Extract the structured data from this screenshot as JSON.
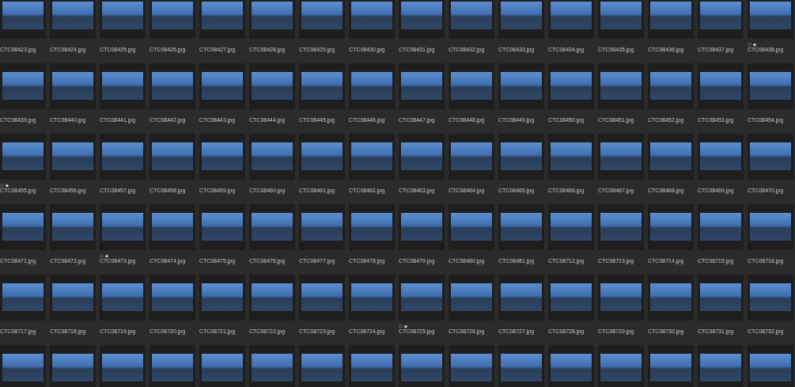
{
  "rows": [
    {
      "items": [
        {
          "filename": "CTC08423.jpg",
          "starred": false
        },
        {
          "filename": "CTC08424.jpg",
          "starred": false
        },
        {
          "filename": "CTC08425.jpg",
          "starred": false
        },
        {
          "filename": "CTC08426.jpg",
          "starred": false
        },
        {
          "filename": "CTC08427.jpg",
          "starred": false
        },
        {
          "filename": "CTC08428.jpg",
          "starred": false
        },
        {
          "filename": "CTC08429.jpg",
          "starred": false
        },
        {
          "filename": "CTC08430.jpg",
          "starred": false
        },
        {
          "filename": "CTC08431.jpg",
          "starred": false
        },
        {
          "filename": "CTC08432.jpg",
          "starred": false
        },
        {
          "filename": "CTC08433.jpg",
          "starred": false
        },
        {
          "filename": "CTC08434.jpg",
          "starred": false
        },
        {
          "filename": "CTC08435.jpg",
          "starred": false
        },
        {
          "filename": "CTC08436.jpg",
          "starred": false
        },
        {
          "filename": "CTC08437.jpg",
          "starred": false
        },
        {
          "filename": "CTC08438.jpg",
          "starred": true
        }
      ]
    },
    {
      "items": [
        {
          "filename": "CTC08439.jpg",
          "starred": false
        },
        {
          "filename": "CTC08440.jpg",
          "starred": false
        },
        {
          "filename": "CTC08441.jpg",
          "starred": false
        },
        {
          "filename": "CTC08442.jpg",
          "starred": false
        },
        {
          "filename": "CTC08443.jpg",
          "starred": false
        },
        {
          "filename": "CTC08444.jpg",
          "starred": false
        },
        {
          "filename": "CTC08445.jpg",
          "starred": false
        },
        {
          "filename": "CTC08446.jpg",
          "starred": false
        },
        {
          "filename": "CTC08447.jpg",
          "starred": false
        },
        {
          "filename": "CTC08448.jpg",
          "starred": false
        },
        {
          "filename": "CTC08449.jpg",
          "starred": false
        },
        {
          "filename": "CTC08450.jpg",
          "starred": false
        },
        {
          "filename": "CTC08451.jpg",
          "starred": false
        },
        {
          "filename": "CTC08452.jpg",
          "starred": false
        },
        {
          "filename": "CTC08453.jpg",
          "starred": false
        },
        {
          "filename": "CTC08454.jpg",
          "starred": false
        }
      ]
    },
    {
      "items": [
        {
          "filename": "CTC08455.jpg",
          "starred": true
        },
        {
          "filename": "CTC08456.jpg",
          "starred": false
        },
        {
          "filename": "CTC08457.jpg",
          "starred": false
        },
        {
          "filename": "CTC08458.jpg",
          "starred": false
        },
        {
          "filename": "CTC08459.jpg",
          "starred": false
        },
        {
          "filename": "CTC08460.jpg",
          "starred": false
        },
        {
          "filename": "CTC08461.jpg",
          "starred": false
        },
        {
          "filename": "CTC08462.jpg",
          "starred": false
        },
        {
          "filename": "CTC08463.jpg",
          "starred": false
        },
        {
          "filename": "CTC08464.jpg",
          "starred": false
        },
        {
          "filename": "CTC08465.jpg",
          "starred": false
        },
        {
          "filename": "CTC08466.jpg",
          "starred": false
        },
        {
          "filename": "CTC08467.jpg",
          "starred": false
        },
        {
          "filename": "CTC08468.jpg",
          "starred": false
        },
        {
          "filename": "CTC08469.jpg",
          "starred": false
        },
        {
          "filename": "CTC08470.jpg",
          "starred": false
        }
      ]
    },
    {
      "items": [
        {
          "filename": "CTC08471.jpg",
          "starred": false
        },
        {
          "filename": "CTC08472.jpg",
          "starred": false
        },
        {
          "filename": "CTC08473.jpg",
          "starred": true
        },
        {
          "filename": "CTC08474.jpg",
          "starred": false
        },
        {
          "filename": "CTC08475.jpg",
          "starred": false
        },
        {
          "filename": "CTC08476.jpg",
          "starred": false
        },
        {
          "filename": "CTC08477.jpg",
          "starred": false
        },
        {
          "filename": "CTC08478.jpg",
          "starred": false
        },
        {
          "filename": "CTC08479.jpg",
          "starred": false
        },
        {
          "filename": "CTC08480.jpg",
          "starred": false
        },
        {
          "filename": "CTC08481.jpg",
          "starred": false
        },
        {
          "filename": "CTC08712.jpg",
          "starred": false
        },
        {
          "filename": "CTC08713.jpg",
          "starred": false
        },
        {
          "filename": "CTC08714.jpg",
          "starred": false
        },
        {
          "filename": "CTC08715.jpg",
          "starred": false
        },
        {
          "filename": "CTC08716.jpg",
          "starred": false
        }
      ]
    },
    {
      "items": [
        {
          "filename": "CTC08717.jpg",
          "starred": false
        },
        {
          "filename": "CTC08718.jpg",
          "starred": false
        },
        {
          "filename": "CTC08719.jpg",
          "starred": false
        },
        {
          "filename": "CTC08720.jpg",
          "starred": false
        },
        {
          "filename": "CTC08721.jpg",
          "starred": false
        },
        {
          "filename": "CTC08722.jpg",
          "starred": false
        },
        {
          "filename": "CTC08723.jpg",
          "starred": false
        },
        {
          "filename": "CTC08724.jpg",
          "starred": false
        },
        {
          "filename": "CTC08725.jpg",
          "starred": true
        },
        {
          "filename": "CTC08726.jpg",
          "starred": false
        },
        {
          "filename": "CTC08727.jpg",
          "starred": false
        },
        {
          "filename": "CTC08728.jpg",
          "starred": false
        },
        {
          "filename": "CTC08729.jpg",
          "starred": false
        },
        {
          "filename": "CTC08730.jpg",
          "starred": false
        },
        {
          "filename": "CTC08731.jpg",
          "starred": false
        },
        {
          "filename": "CTC08732.jpg",
          "starred": false
        }
      ]
    },
    {
      "items": [
        {
          "starred": false
        },
        {
          "starred": false
        },
        {
          "starred": false
        },
        {
          "starred": false
        },
        {
          "starred": false
        },
        {
          "starred": false
        },
        {
          "starred": false
        },
        {
          "starred": false
        },
        {
          "starred": false
        },
        {
          "starred": false
        },
        {
          "starred": false
        },
        {
          "starred": false
        },
        {
          "starred": false
        },
        {
          "starred": false
        },
        {
          "starred": false
        },
        {
          "starred": false
        }
      ]
    }
  ]
}
